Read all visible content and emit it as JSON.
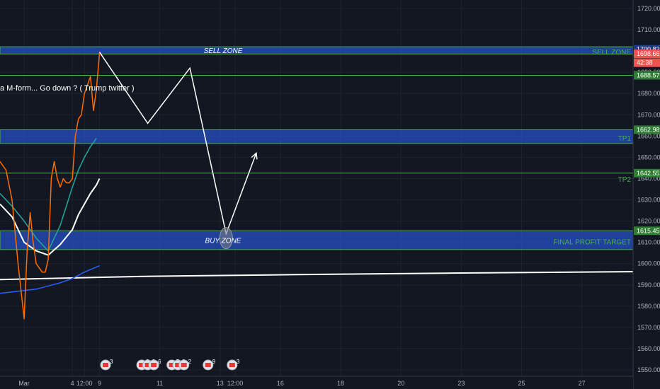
{
  "chart_data": {
    "type": "line",
    "title": "",
    "xlabel": "",
    "ylabel": "",
    "ylim": [
      1547,
      1724
    ],
    "y_ticks": [
      1550,
      1560,
      1570,
      1580,
      1590,
      1600,
      1610,
      1620,
      1630,
      1640,
      1650,
      1660,
      1670,
      1680,
      1690,
      1700,
      1710,
      1720
    ],
    "x_ticks": [
      {
        "label": "Mar",
        "x": 0
      },
      {
        "label": "4",
        "x": 8
      },
      {
        "label": "12:00",
        "x": 10
      },
      {
        "label": "9",
        "x": 12.5
      },
      {
        "label": "11",
        "x": 22.5
      },
      {
        "label": "13",
        "x": 32.5
      },
      {
        "label": "12:00",
        "x": 35
      },
      {
        "label": "16",
        "x": 42.5
      },
      {
        "label": "18",
        "x": 52.5
      },
      {
        "label": "20",
        "x": 62.5
      },
      {
        "label": "23",
        "x": 72.5
      },
      {
        "label": "25",
        "x": 82.5
      },
      {
        "label": "27",
        "x": 92.5
      }
    ],
    "x_range": [
      -4,
      101
    ],
    "grid": true,
    "zones": [
      {
        "label": "SELL ZONE",
        "side_label": "SELL ZONE",
        "y_top": 1702,
        "y_bottom": 1698.6,
        "color": "#2962ff"
      },
      {
        "label": "",
        "side_label": "TP1",
        "y_top": 1662.98,
        "y_bottom": 1656.5,
        "color": "#2962ff"
      },
      {
        "label": "BUY ZONE",
        "side_label": "FINAL PROFIT TARGET",
        "y_top": 1615.45,
        "y_bottom": 1606.6,
        "color": "#2962ff"
      }
    ],
    "levels": [
      {
        "label": "TP2",
        "y": 1642.55,
        "color": "#4caf50"
      },
      {
        "label": "",
        "y": 1688.57,
        "color": "#4caf50"
      }
    ],
    "price_tags": [
      {
        "text": "1700.82",
        "y": 1700.82,
        "style": "zone"
      },
      {
        "text": "1698.66",
        "y": 1698.66,
        "style": "price"
      },
      {
        "text": "42:38",
        "y": 1694.5,
        "style": "timer"
      },
      {
        "text": "1688.57",
        "y": 1688.57,
        "style": "level"
      },
      {
        "text": "1662.98",
        "y": 1662.98,
        "style": "level"
      },
      {
        "text": "1642.55",
        "y": 1642.55,
        "style": "level"
      },
      {
        "text": "1615.45",
        "y": 1615.45,
        "style": "level"
      }
    ],
    "annotation": "a M-form... Go down ? ( Trump twitter )",
    "series": [
      {
        "name": "",
        "color": "#ffffff",
        "x": [
          -4,
          -2,
          0,
          2,
          4,
          6,
          8,
          9,
          10,
          11,
          12,
          12.5
        ],
        "values": [
          1628,
          1622,
          1610,
          1606,
          1604,
          1609,
          1616,
          1623,
          1628,
          1633,
          1637,
          1640
        ]
      },
      {
        "name": "",
        "color": "#ffffff",
        "x": [
          -4,
          20,
          45,
          70,
          101
        ],
        "values": [
          1592.5,
          1594,
          1594.8,
          1595.5,
          1596.2
        ]
      },
      {
        "name": "",
        "color": "#26a69a",
        "x": [
          -4,
          -2,
          0,
          2,
          4,
          6,
          8,
          9,
          10,
          11,
          12
        ],
        "values": [
          1633,
          1627,
          1620,
          1612,
          1606,
          1618,
          1636,
          1644,
          1650,
          1655,
          1659
        ]
      },
      {
        "name": "",
        "color": "#2962ff",
        "x": [
          -4,
          2,
          6,
          8,
          10,
          12.5
        ],
        "values": [
          1586,
          1588,
          1591,
          1593,
          1596,
          1599
        ]
      },
      {
        "name": "",
        "color": "#ff6d00",
        "x": [
          -4,
          -3,
          -2,
          -1,
          0,
          0.5,
          1,
          1.5,
          2,
          2.5,
          3,
          3.5,
          4,
          4.5,
          5,
          5.5,
          6,
          6.5,
          7,
          7.5,
          8,
          8.5,
          9,
          9.5,
          10,
          10.5,
          11,
          11.5,
          12,
          12.5
        ],
        "values": [
          1648,
          1644,
          1630,
          1600,
          1574,
          1606,
          1624,
          1610,
          1600,
          1598,
          1596,
          1596,
          1602,
          1640,
          1648,
          1640,
          1636,
          1640,
          1638,
          1638,
          1640,
          1660,
          1668,
          1670,
          1680,
          1684,
          1688,
          1672,
          1682,
          1699
        ]
      }
    ],
    "projection": {
      "x": [
        12.5,
        20.5,
        27.5,
        33.5,
        38.5
      ],
      "values": [
        1699.5,
        1666,
        1692,
        1614,
        1652
      ]
    },
    "event_markers": [
      {
        "x": 13.5,
        "count": "3"
      },
      {
        "x": 19.5,
        "count": "2"
      },
      {
        "x": 20.5,
        "count": "2"
      },
      {
        "x": 21.5,
        "count": "6"
      },
      {
        "x": 24.5,
        "count": "5"
      },
      {
        "x": 25.5,
        "count": "2"
      },
      {
        "x": 26.5,
        "count": "2"
      },
      {
        "x": 30.5,
        "count": "9"
      },
      {
        "x": 34.5,
        "count": "3"
      }
    ]
  }
}
